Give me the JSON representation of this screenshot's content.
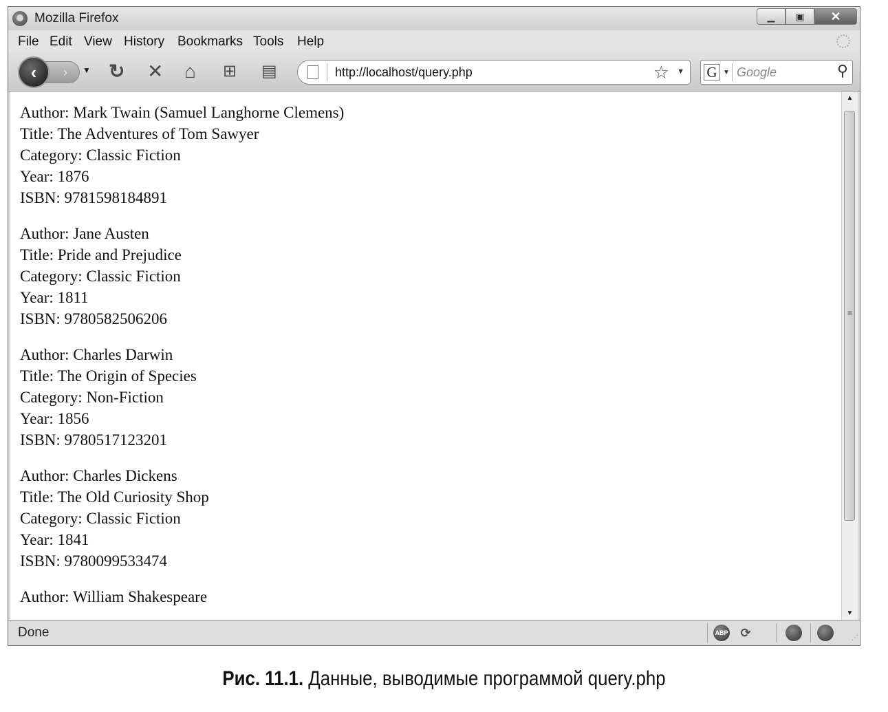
{
  "window": {
    "title": "Mozilla Firefox"
  },
  "menu": [
    "File",
    "Edit",
    "View",
    "History",
    "Bookmarks",
    "Tools",
    "Help"
  ],
  "nav": {
    "icons": [
      "back-icon",
      "forward-icon",
      "reload-icon",
      "stop-icon",
      "home-icon",
      "new-tab-icon",
      "print-icon"
    ],
    "url": "http://localhost/query.php",
    "search_placeholder": "Google",
    "search_engine": "G"
  },
  "records": [
    {
      "author": "Author: Mark Twain (Samuel Langhorne Clemens)",
      "title": "Title: The Adventures of Tom Sawyer",
      "category": "Category: Classic Fiction",
      "year": "Year: 1876",
      "isbn": "ISBN: 9781598184891"
    },
    {
      "author": "Author: Jane Austen",
      "title": "Title: Pride and Prejudice",
      "category": "Category: Classic Fiction",
      "year": "Year: 1811",
      "isbn": "ISBN: 9780582506206"
    },
    {
      "author": "Author: Charles Darwin",
      "title": "Title: The Origin of Species",
      "category": "Category: Non-Fiction",
      "year": "Year: 1856",
      "isbn": "ISBN: 9780517123201"
    },
    {
      "author": "Author: Charles Dickens",
      "title": "Title: The Old Curiosity Shop",
      "category": "Category: Classic Fiction",
      "year": "Year: 1841",
      "isbn": "ISBN: 9780099533474"
    },
    {
      "author": "Author: William Shakespeare"
    }
  ],
  "status": {
    "text": "Done",
    "icons": [
      "adblock-icon",
      "greasemonkey-icon",
      "firebug-icon",
      "firefox-icon"
    ],
    "adblock_label": "ABP"
  },
  "caption": {
    "label": "Рис. 11.1.",
    "text": "Данные, выводимые программой query.php"
  }
}
